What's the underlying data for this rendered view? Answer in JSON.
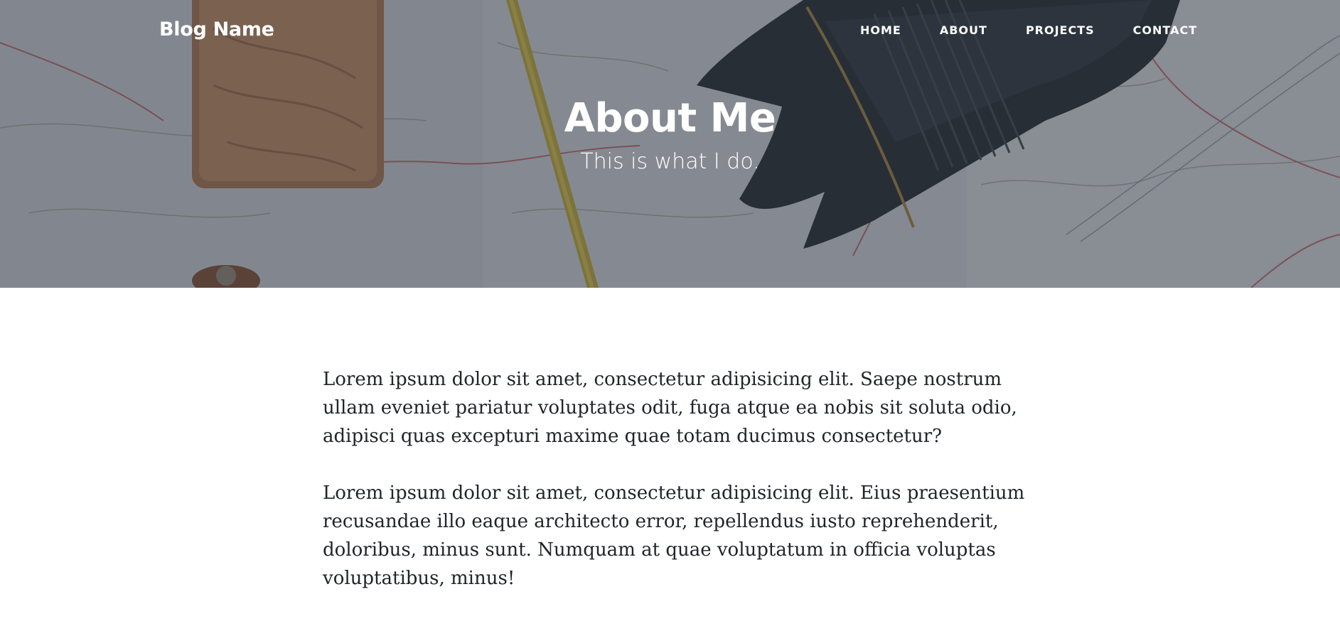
{
  "header": {
    "brand": "Blog Name",
    "nav": [
      {
        "label": "HOME"
      },
      {
        "label": "ABOUT"
      },
      {
        "label": "PROJECTS"
      },
      {
        "label": "CONTACT"
      }
    ]
  },
  "hero": {
    "title": "About Me",
    "subtitle": "This is what I do."
  },
  "main": {
    "paragraphs": [
      "Lorem ipsum dolor sit amet, consectetur adipisicing elit. Saepe nostrum ullam eveniet pariatur voluptates odit, fuga atque ea nobis sit soluta odio, adipisci quas excepturi maxime quae totam ducimus consectetur?",
      "Lorem ipsum dolor sit amet, consectetur adipisicing elit. Eius praesentium recusandae illo eaque architecto error, repellendus iusto reprehenderit, doloribus, minus sunt. Numquam at quae voluptatum in officia voluptas voluptatibus, minus!"
    ]
  },
  "colors": {
    "overlay": "#343a44",
    "text": "#212529",
    "header_text": "#ffffff"
  }
}
